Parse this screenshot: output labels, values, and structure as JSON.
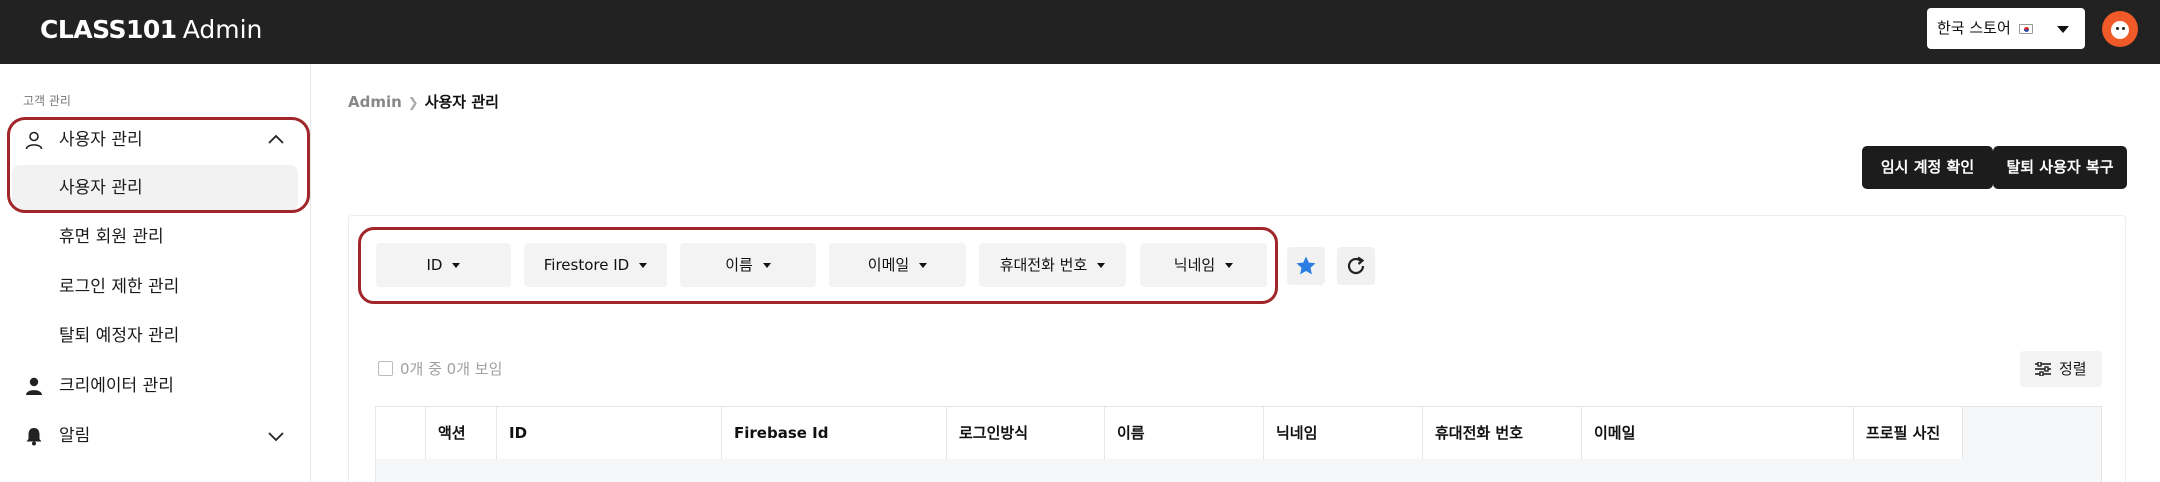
{
  "header": {
    "brand": "CLASS101",
    "admin": "Admin",
    "store_label": "한국 스토어"
  },
  "sidebar": {
    "section_label": "고객 관리",
    "groups": [
      {
        "label": "사용자 관리",
        "icon": "user-outline-icon",
        "expanded": true,
        "children": [
          "사용자 관리",
          "휴면 회원 관리",
          "로그인 제한 관리",
          "탈퇴 예정자 관리"
        ]
      },
      {
        "label": "크리에이터 관리",
        "icon": "user-filled-icon"
      },
      {
        "label": "알림",
        "icon": "bell-icon",
        "expanded": false
      }
    ]
  },
  "breadcrumb": {
    "root": "Admin",
    "current": "사용자 관리"
  },
  "actions": {
    "temp_account": "임시 계정 확인",
    "restore_user": "탈퇴 사용자 복구"
  },
  "filters": [
    "ID",
    "Firestore ID",
    "이름",
    "이메일",
    "휴대전화 번호",
    "닉네임"
  ],
  "count_text": "0개 중 0개 보임",
  "sort_label": "정렬",
  "table": {
    "columns": [
      "액션",
      "ID",
      "Firebase Id",
      "로그인방식",
      "이름",
      "닉네임",
      "휴대전화 번호",
      "이메일",
      "프로필 사진"
    ]
  },
  "colors": {
    "topbar": "#222222",
    "highlight": "#a0262a",
    "star": "#2a7de1",
    "avatar": "#f05a28"
  }
}
